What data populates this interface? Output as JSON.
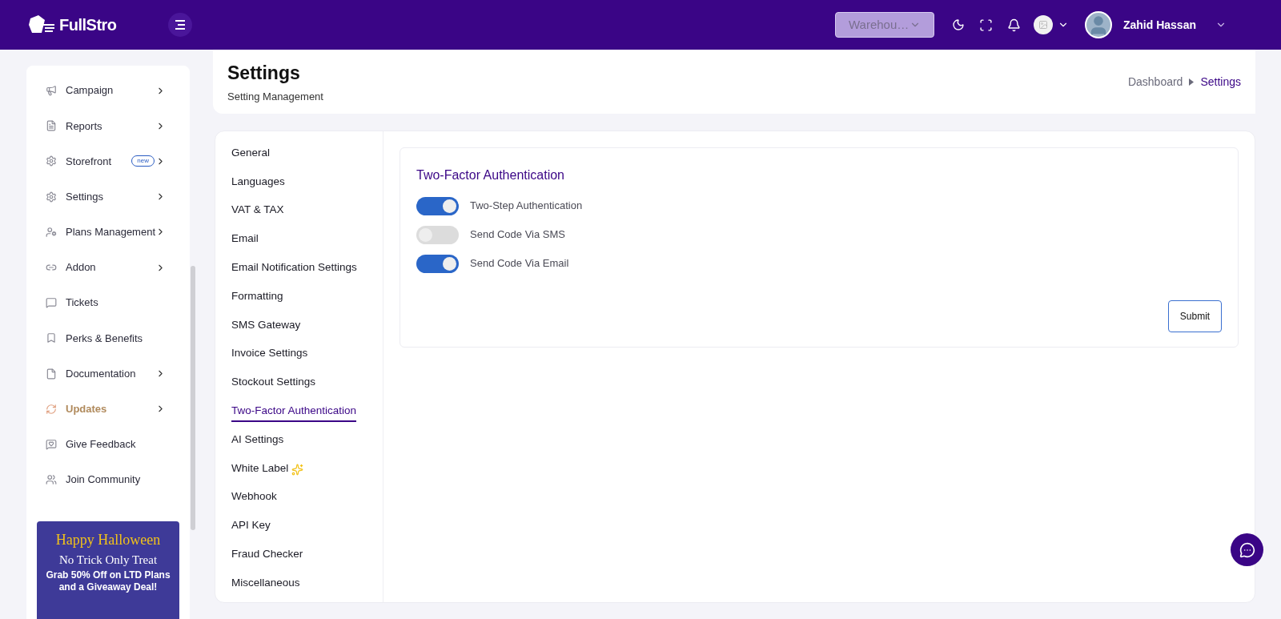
{
  "header": {
    "logo": "FullStro",
    "warehouse_select": {
      "placeholder": "Warehou…"
    },
    "user_name": "Zahid Hassan"
  },
  "sidebar": {
    "items": [
      {
        "label": "Campaign",
        "submenu": true,
        "selected": false
      },
      {
        "label": "Reports",
        "submenu": true,
        "selected": false
      },
      {
        "label": "Storefront",
        "submenu": true,
        "badge": "new",
        "selected": false
      },
      {
        "label": "Settings",
        "submenu": true,
        "selected": false
      },
      {
        "label": "Plans Management",
        "submenu": true,
        "selected": false
      },
      {
        "label": "Addon",
        "submenu": true,
        "selected": false
      },
      {
        "label": "Tickets",
        "submenu": false,
        "selected": false
      },
      {
        "label": "Perks & Benefits",
        "submenu": false,
        "selected": false
      },
      {
        "label": "Documentation",
        "submenu": true,
        "selected": false
      },
      {
        "label": "Updates",
        "submenu": true,
        "selected": true
      },
      {
        "label": "Give Feedback",
        "submenu": false,
        "selected": false
      },
      {
        "label": "Join Community",
        "submenu": false,
        "selected": false
      }
    ],
    "banner": {
      "title": "Happy Halloween",
      "subtitle": "No Trick Only Treat",
      "offer": "Grab 50% Off on LTD Plans and a Giveaway Deal!"
    }
  },
  "page": {
    "title": "Settings",
    "subtitle": "Setting Management",
    "breadcrumb": [
      {
        "label": "Dashboard",
        "selected": false
      },
      {
        "label": "Settings",
        "selected": true
      }
    ]
  },
  "settings_nav": [
    {
      "label": "General",
      "selected": false
    },
    {
      "label": "Languages",
      "selected": false
    },
    {
      "label": "VAT & TAX",
      "selected": false
    },
    {
      "label": "Email",
      "selected": false
    },
    {
      "label": "Email Notification Settings",
      "selected": false
    },
    {
      "label": "Formatting",
      "selected": false
    },
    {
      "label": "SMS Gateway",
      "selected": false
    },
    {
      "label": "Invoice Settings",
      "selected": false
    },
    {
      "label": "Stockout Settings",
      "selected": false
    },
    {
      "label": "Two-Factor Authentication",
      "selected": true
    },
    {
      "label": "AI Settings",
      "selected": false
    },
    {
      "label": "White Label",
      "selected": false,
      "sparkle": true
    },
    {
      "label": "Webhook",
      "selected": false
    },
    {
      "label": "API Key",
      "selected": false
    },
    {
      "label": "Fraud Checker",
      "selected": false
    },
    {
      "label": "Miscellaneous",
      "selected": false
    }
  ],
  "panel": {
    "title": "Two-Factor Authentication",
    "toggles": [
      {
        "label": "Two-Step Authentication",
        "on": true
      },
      {
        "label": "Send Code Via SMS",
        "on": false
      },
      {
        "label": "Send Code Via Email",
        "on": true
      }
    ],
    "submit": "Submit"
  }
}
